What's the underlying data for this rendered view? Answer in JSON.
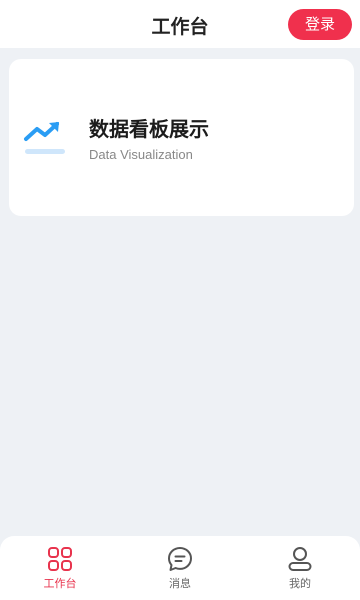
{
  "header": {
    "title": "工作台",
    "login_label": "登录"
  },
  "card": {
    "title": "数据看板展示",
    "subtitle": "Data Visualization",
    "icon": "trending-up-icon"
  },
  "tabbar": {
    "tabs": [
      {
        "label": "工作台",
        "icon": "grid-icon",
        "active": true
      },
      {
        "label": "消息",
        "icon": "message-icon",
        "active": false
      },
      {
        "label": "我的",
        "icon": "user-icon",
        "active": false
      }
    ]
  },
  "colors": {
    "accent": "#f0304d",
    "background": "#eef1f5",
    "icon_blue": "#2a9df4"
  }
}
